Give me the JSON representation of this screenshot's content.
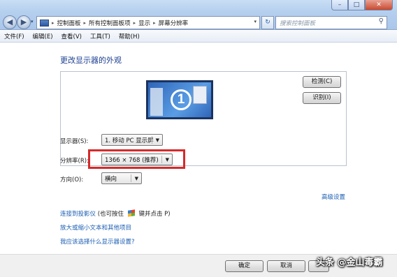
{
  "window": {
    "minimize_glyph": "–",
    "maximize_glyph": "□",
    "close_glyph": "✕"
  },
  "nav": {
    "back_glyph": "◀",
    "forward_glyph": "▶",
    "recent_glyph": "▾"
  },
  "address": {
    "crumbs": [
      "控制面板",
      "所有控制面板项",
      "显示",
      "屏幕分辨率"
    ],
    "separator": "▸",
    "dropdown_glyph": "▾",
    "refresh_glyph": "↻"
  },
  "search": {
    "placeholder": "搜索控制面板",
    "icon": "search-icon",
    "glyph": "⚲"
  },
  "menu": [
    "文件(F)",
    "编辑(E)",
    "查看(V)",
    "工具(T)",
    "帮助(H)"
  ],
  "page": {
    "title": "更改显示器的外观",
    "monitor_number": "1",
    "detect_label": "检测(C)",
    "identify_label": "识别(I)"
  },
  "fields": {
    "display_label": "显示器(S):",
    "display_value": "1. 移动 PC 显示屏",
    "resolution_label": "分辨率(R):",
    "resolution_value": "1366 × 768 (推荐)",
    "orientation_label": "方向(O):",
    "orientation_value": "横向",
    "dropdown_glyph": "▼"
  },
  "links": {
    "advanced": "高级设置",
    "projector_link": "连接到投影仪",
    "projector_tail_before": "(也可按住",
    "projector_tail_after": "键并点击 P)",
    "enlarge": "放大或缩小文本和其他项目",
    "which_settings": "我应该选择什么显示器设置?"
  },
  "footer": {
    "ok_label": "确定",
    "cancel_label": "取消",
    "apply_label": ""
  },
  "watermark": "头条 @金山毒霸",
  "colors": {
    "link": "#1a5db3",
    "title": "#1b3f91",
    "highlight": "#d52a2a"
  }
}
